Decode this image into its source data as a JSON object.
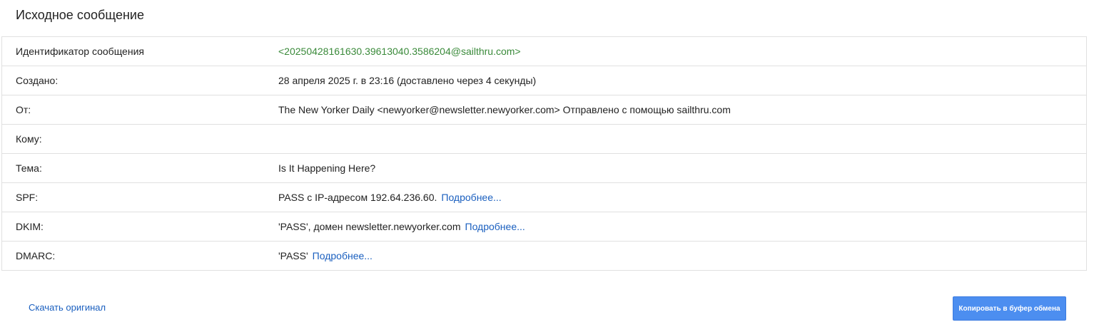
{
  "page": {
    "title": "Исходное сообщение"
  },
  "rows": [
    {
      "label": "Идентификатор сообщения",
      "value": "<20250428161630.39613040.3586204@sailthru.com>",
      "link": ""
    },
    {
      "label": "Создано:",
      "value": "28 апреля 2025 г. в 23:16 (доставлено через 4 секунды)",
      "link": ""
    },
    {
      "label": "От:",
      "value": "The New Yorker Daily <newyorker@newsletter.newyorker.com> Отправлено с помощью sailthru.com",
      "link": ""
    },
    {
      "label": "Кому:",
      "value": "",
      "link": ""
    },
    {
      "label": "Тема:",
      "value": "Is It Happening Here?",
      "link": ""
    },
    {
      "label": "SPF:",
      "value": "PASS с IP-адресом 192.64.236.60.",
      "link": "Подробнее..."
    },
    {
      "label": "DKIM:",
      "value": "'PASS', домен newsletter.newyorker.com",
      "link": "Подробнее..."
    },
    {
      "label": "DMARC:",
      "value": "'PASS'",
      "link": "Подробнее..."
    }
  ],
  "actions": {
    "download_label": "Скачать оригинал",
    "copy_label": "Копировать в буфер обмена"
  },
  "colors": {
    "message_id": "#3a8a3a",
    "link": "#1a5fbf",
    "button": "#4c8ef0"
  }
}
